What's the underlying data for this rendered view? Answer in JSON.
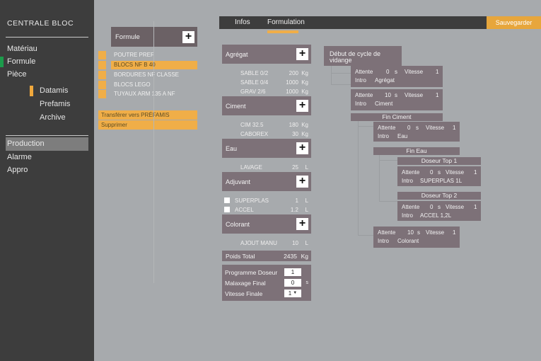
{
  "app": {
    "sidebar_title": "CENTRALE BLOC",
    "accent_orange": "#f0ae48",
    "accent_green": "#1c9b4b",
    "panel_mauve": "#7d7178",
    "bg_gray": "#a7aaad",
    "sidebar_dark": "#3d3d3d"
  },
  "sidebar": {
    "items": [
      {
        "label": "Matériau",
        "state": "normal"
      },
      {
        "label": "Formule",
        "state": "active-green"
      },
      {
        "label": "Pièce",
        "state": "normal"
      },
      {
        "label": "Datamis",
        "state": "active-orange-sub"
      },
      {
        "label": "Prefamis",
        "state": "sub"
      },
      {
        "label": "Archive",
        "state": "sub"
      },
      {
        "label": "Production",
        "state": "highlight"
      },
      {
        "label": "Alarme",
        "state": "normal"
      },
      {
        "label": "Appro",
        "state": "normal"
      }
    ]
  },
  "formula_list": {
    "header_label": "Formule",
    "add_icon": "plus-icon",
    "rows": [
      {
        "label": "POUTRE PREF",
        "selected": false
      },
      {
        "label": "BLOCS NF B 40",
        "selected": true
      },
      {
        "label": "BORDURES  NF CLASSE",
        "selected": false
      },
      {
        "label": "BLOCS LEGO",
        "selected": false
      },
      {
        "label": "TUYAUX ARM 135 A NF",
        "selected": false
      }
    ],
    "transfer_label": "Transférer vers PRÉFAMIS",
    "delete_label": "Supprimer"
  },
  "header": {
    "tabs": [
      {
        "label": "Infos",
        "active": false
      },
      {
        "label": "Formulation",
        "active": true
      }
    ],
    "save_label": "Sauvegarder"
  },
  "ingredients": {
    "groups": [
      {
        "title": "Agrégat",
        "add_icon": "plus-icon",
        "rows": [
          {
            "name": "SABLE 0/2",
            "value": "200",
            "unit": "Kg"
          },
          {
            "name": "SABLE 0/4",
            "value": "1000",
            "unit": "Kg"
          },
          {
            "name": "GRAV 2/6",
            "value": "1000",
            "unit": "Kg"
          }
        ]
      },
      {
        "title": "Ciment",
        "add_icon": "plus-icon",
        "rows": [
          {
            "name": "CIM 32.5",
            "value": "180",
            "unit": "Kg"
          },
          {
            "name": "CABOREX",
            "value": "30",
            "unit": "Kg"
          }
        ]
      },
      {
        "title": "Eau",
        "add_icon": "plus-icon",
        "rows": [
          {
            "name": "LAVAGE",
            "value": "25",
            "unit": "L"
          }
        ]
      },
      {
        "title": "Adjuvant",
        "add_icon": "plus-icon",
        "rows": [
          {
            "name": "SUPERPLAS",
            "value": "1",
            "unit": "L",
            "checkbox": true,
            "checked": false
          },
          {
            "name": "ACCEL",
            "value": "1.2",
            "unit": "L",
            "checkbox": true,
            "checked": false
          }
        ]
      },
      {
        "title": "Colorant",
        "add_icon": "plus-icon",
        "rows": [
          {
            "name": "AJOUT MANU",
            "value": "10",
            "unit": "L"
          }
        ]
      }
    ],
    "total": {
      "label": "Poids Total",
      "value": "2435",
      "unit": "Kg"
    },
    "params": [
      {
        "label": "Programme Doseur",
        "value": "1",
        "unit": "",
        "select": false
      },
      {
        "label": "Malaxage Final",
        "value": "0",
        "unit": "s",
        "select": false
      },
      {
        "label": "Vitesse Finale",
        "value": "1",
        "unit": "",
        "select": true
      }
    ]
  },
  "flow": {
    "start_label": "Début de cycle de vidange",
    "steps": [
      {
        "kind": "step",
        "attente_label": "Attente",
        "attente_value": "0",
        "attente_unit": "s",
        "vitesse_label": "Vitesse",
        "vitesse_value": "1",
        "intro_label": "Intro",
        "intro_value": "Agrégat"
      },
      {
        "kind": "step",
        "attente_label": "Attente",
        "attente_value": "10",
        "attente_unit": "s",
        "vitesse_label": "Vitesse",
        "vitesse_value": "1",
        "intro_label": "Intro",
        "intro_value": "Ciment"
      },
      {
        "kind": "bar",
        "label": "Fin Ciment"
      },
      {
        "kind": "step",
        "attente_label": "Attente",
        "attente_value": "0",
        "attente_unit": "s",
        "vitesse_label": "Vitesse",
        "vitesse_value": "1",
        "intro_label": "Intro",
        "intro_value": "Eau"
      },
      {
        "kind": "bar",
        "label": "Fin Eau"
      },
      {
        "kind": "bar",
        "label": "Doseur Top 1"
      },
      {
        "kind": "step",
        "attente_label": "Attente",
        "attente_value": "0",
        "attente_unit": "s",
        "vitesse_label": "Vitesse",
        "vitesse_value": "1",
        "intro_label": "Intro",
        "intro_value": "SUPERPLAS 1L"
      },
      {
        "kind": "bar",
        "label": "Doseur Top 2"
      },
      {
        "kind": "step",
        "attente_label": "Attente",
        "attente_value": "0",
        "attente_unit": "s",
        "vitesse_label": "Vitesse",
        "vitesse_value": "1",
        "intro_label": "Intro",
        "intro_value": "ACCEL 1,2L"
      },
      {
        "kind": "step",
        "attente_label": "Attente",
        "attente_value": "10",
        "attente_unit": "s",
        "vitesse_label": "Vitesse",
        "vitesse_value": "1",
        "intro_label": "Intro",
        "intro_value": "Colorant"
      }
    ]
  }
}
